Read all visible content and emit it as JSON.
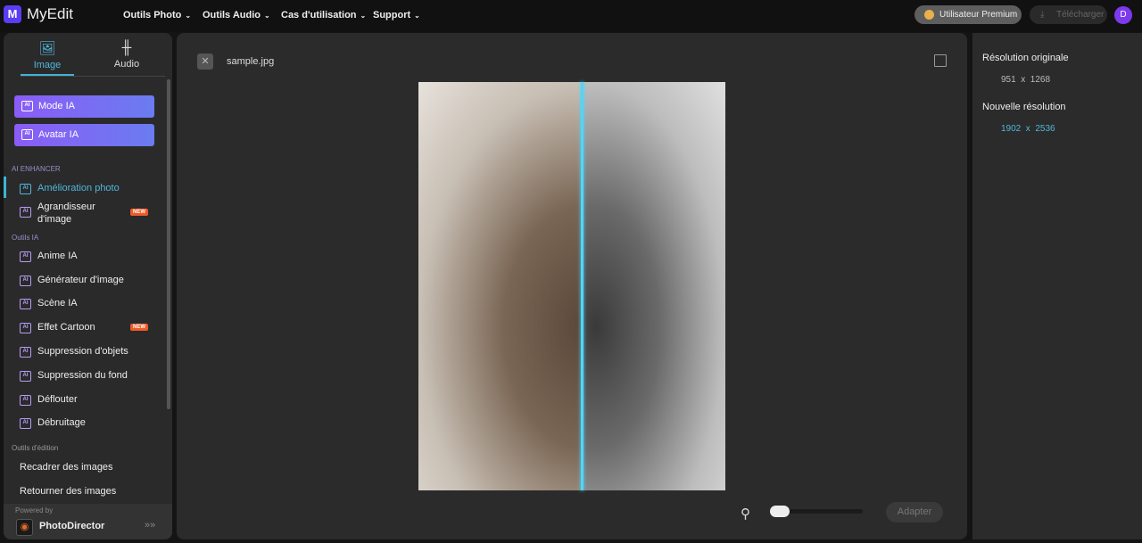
{
  "header": {
    "brand": "MyEdit",
    "logo_letter": "M",
    "nav": [
      "Outils Photo",
      "Outils Audio",
      "Cas d'utilisation",
      "Support"
    ],
    "premium": "Utilisateur Premium",
    "download": "Télécharger",
    "avatar": "D"
  },
  "sidebar": {
    "tabs": [
      {
        "label": "Image",
        "icon": "image-icon"
      },
      {
        "label": "Audio",
        "icon": "waveform-icon"
      }
    ],
    "primary": [
      "Mode IA",
      "Avatar IA"
    ],
    "sections": {
      "enhancer": "AI ENHANCER",
      "ia": "Outils IA",
      "edit": "Outils d'édition"
    },
    "enhancer_items": [
      {
        "label": "Amélioration photo"
      },
      {
        "label": "Agrandisseur d'image",
        "badge": "NEW"
      }
    ],
    "ia_items": [
      {
        "label": "Anime IA"
      },
      {
        "label": "Générateur d'image"
      },
      {
        "label": "Scène IA"
      },
      {
        "label": "Effet Cartoon",
        "badge": "NEW"
      },
      {
        "label": "Suppression d'objets"
      },
      {
        "label": "Suppression du fond"
      },
      {
        "label": "Déflouter"
      },
      {
        "label": "Débruitage"
      }
    ],
    "edit_items": [
      "Recadrer des images",
      "Retourner des images"
    ],
    "footer": {
      "powered": "Powered by",
      "product": "PhotoDirector"
    }
  },
  "main": {
    "filename": "sample.jpg",
    "zoom_fraction": 0.0,
    "compare_position": 0.53,
    "adapt": "Adapter"
  },
  "right": {
    "orig_label": "Résolution originale",
    "orig_value": "951  x  1268",
    "new_label": "Nouvelle résolution",
    "new_value": "1902  x  2536"
  },
  "colors": {
    "accent": "#4fb7dd",
    "purple": "#8b5cf6",
    "new_badge": "#f05a28"
  }
}
